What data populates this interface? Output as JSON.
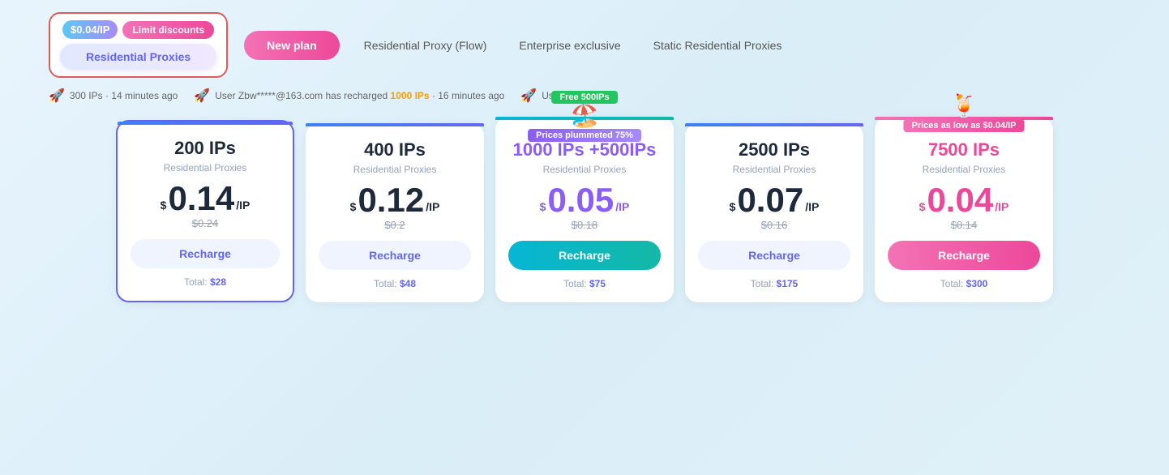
{
  "nav": {
    "price_tag": "$0.04/IP",
    "limit_badge": "Limit discounts",
    "new_plan_btn": "New plan",
    "tabs": [
      {
        "label": "Residential Proxies",
        "active": true
      },
      {
        "label": "Residential Proxy (Flow)"
      },
      {
        "label": "Enterprise exclusive"
      },
      {
        "label": "Static Residential Proxies"
      }
    ]
  },
  "notice": {
    "items": [
      {
        "text": "300 IPs · 14 minutes ago",
        "icon": "🚀"
      },
      {
        "text": "User Zbw*****@163.com has recharged ",
        "highlight": "1000 IPs",
        "suffix": " · 16 minutes ago",
        "icon": "🚀"
      },
      {
        "text": "User Zbw****",
        "icon": "🚀"
      }
    ]
  },
  "plans": [
    {
      "ip_count": "200 IPs",
      "type": "Residential Proxies",
      "price_dollar": "$",
      "price_main": "0.14",
      "price_unit": "/IP",
      "price_original": "$0.24",
      "btn_label": "Recharge",
      "btn_type": "default",
      "total_label": "Total:",
      "total_value": "$28",
      "highlighted": true,
      "separator": "blue"
    },
    {
      "ip_count": "400 IPs",
      "type": "Residential Proxies",
      "price_dollar": "$",
      "price_main": "0.12",
      "price_unit": "/IP",
      "price_original": "$0.2",
      "btn_label": "Recharge",
      "btn_type": "default",
      "total_label": "Total:",
      "total_value": "$48",
      "highlighted": false,
      "separator": "blue"
    },
    {
      "ip_count": "1000 IPs +500IPs",
      "type": "Residential Proxies",
      "price_dollar": "$",
      "price_main": "0.05",
      "price_unit": "/IP",
      "price_original": "$0.18",
      "btn_label": "Recharge",
      "btn_type": "gradient-teal",
      "total_label": "Total:",
      "total_value": "$75",
      "highlighted": false,
      "separator": "teal",
      "badge_top": "Free 500IPs",
      "badge_color": "green",
      "badge_sub": "Prices plummeted 75%",
      "badge_sub_color": "purple",
      "badge_icon": "🏖️",
      "color": "purple"
    },
    {
      "ip_count": "2500 IPs",
      "type": "Residential Proxies",
      "price_dollar": "$",
      "price_main": "0.07",
      "price_unit": "/IP",
      "price_original": "$0.16",
      "btn_label": "Recharge",
      "btn_type": "default",
      "total_label": "Total:",
      "total_value": "$175",
      "highlighted": false,
      "separator": "blue"
    },
    {
      "ip_count": "7500 IPs",
      "type": "Residential Proxies",
      "price_dollar": "$",
      "price_main": "0.04",
      "price_unit": "/IP",
      "price_original": "$0.14",
      "btn_label": "Recharge",
      "btn_type": "gradient-pink",
      "total_label": "Total:",
      "total_value": "$300",
      "highlighted": false,
      "separator": "pink",
      "badge_top": "Prices as low as $0.04/IP",
      "badge_color": "teal",
      "badge_icon": "🍹",
      "color": "pink"
    }
  ]
}
